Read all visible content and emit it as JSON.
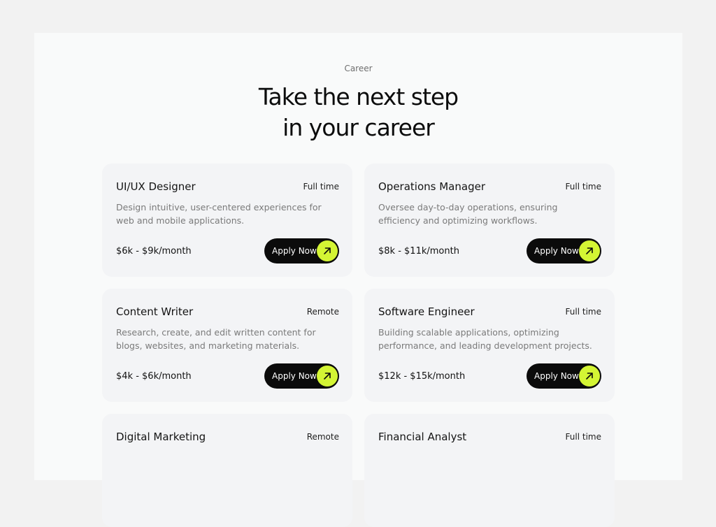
{
  "section": {
    "eyebrow": "Career",
    "headline_line1": "Take the next step",
    "headline_line2": "in your career"
  },
  "colors": {
    "page_background": "#f2f2f2",
    "panel_background": "#f9fafa",
    "card_background": "#f3f4f6",
    "button_background": "#0b0b0b",
    "accent": "#d4f534"
  },
  "jobs": [
    {
      "title": "UI/UX Designer",
      "type": "Full time",
      "description": "Design intuitive, user-centered experiences for web and mobile applications.",
      "salary": "$6k - $9k/month",
      "button_label": "Apply Now",
      "button_icon": "arrow-up-right-icon"
    },
    {
      "title": "Operations Manager",
      "type": "Full time",
      "description": "Oversee day-to-day operations, ensuring efficiency and optimizing workflows.",
      "salary": "$8k - $11k/month",
      "button_label": "Apply Now",
      "button_icon": "arrow-up-right-icon"
    },
    {
      "title": "Content Writer",
      "type": "Remote",
      "description": "Research, create, and edit written content for blogs, websites, and marketing materials.",
      "salary": "$4k - $6k/month",
      "button_label": "Apply Now",
      "button_icon": "arrow-up-right-icon"
    },
    {
      "title": "Software Engineer",
      "type": "Full time",
      "description": "Building scalable applications, optimizing performance, and leading development projects.",
      "salary": "$12k - $15k/month",
      "button_label": "Apply Now",
      "button_icon": "arrow-up-right-icon"
    },
    {
      "title": "Digital Marketing",
      "type": "Remote",
      "description": "",
      "salary": "",
      "button_label": "",
      "button_icon": ""
    },
    {
      "title": "Financial Analyst",
      "type": "Full time",
      "description": "",
      "salary": "",
      "button_label": "",
      "button_icon": ""
    }
  ]
}
